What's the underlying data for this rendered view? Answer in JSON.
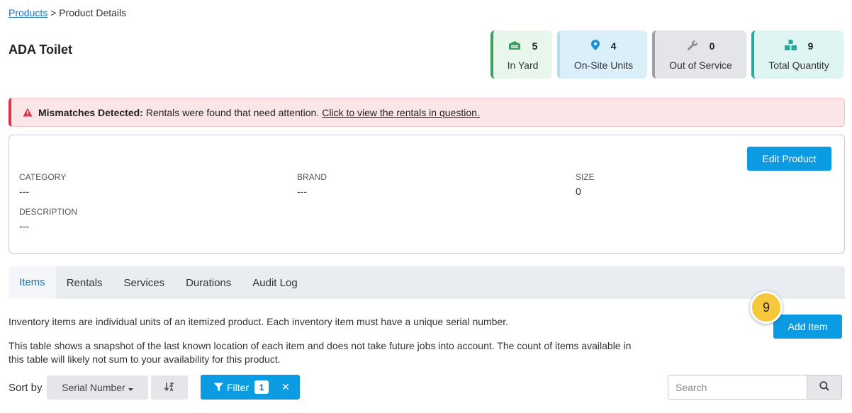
{
  "breadcrumb": {
    "link": "Products",
    "separator": ">",
    "current": "Product Details"
  },
  "product": {
    "title": "ADA Toilet"
  },
  "stats": [
    {
      "value": "5",
      "label": "In Yard",
      "icon": "warehouse-icon",
      "color": "#3aa160"
    },
    {
      "value": "4",
      "label": "On-Site Units",
      "icon": "map-pin-icon",
      "color": "#1a8fd6"
    },
    {
      "value": "0",
      "label": "Out of Service",
      "icon": "wrench-icon",
      "color": "#8b8f94"
    },
    {
      "value": "9",
      "label": "Total Quantity",
      "icon": "boxes-icon",
      "color": "#2aa89e"
    }
  ],
  "alert": {
    "title": "Mismatches Detected:",
    "message": "Rentals were found that need attention.",
    "link": "Click to view the rentals in question.",
    "color": "#d9344a"
  },
  "details": {
    "edit_label": "Edit Product",
    "fields": [
      {
        "label": "CATEGORY",
        "value": "---"
      },
      {
        "label": "BRAND",
        "value": "---"
      },
      {
        "label": "SIZE",
        "value": "0"
      },
      {
        "label": "DESCRIPTION",
        "value": "---"
      }
    ]
  },
  "tabs": [
    {
      "label": "Items",
      "active": true
    },
    {
      "label": "Rentals",
      "active": false
    },
    {
      "label": "Services",
      "active": false
    },
    {
      "label": "Durations",
      "active": false
    },
    {
      "label": "Audit Log",
      "active": false
    }
  ],
  "items_tab": {
    "description_1": "Inventory items are individual units of an itemized product. Each inventory item must have a unique serial number.",
    "description_2": "This table shows a snapshot of the last known location of each item and does not take future jobs into account. The count of items available in this table will likely not sum to your availability for this product.",
    "add_item_label": "Add Item",
    "step_badge": "9"
  },
  "toolbar": {
    "sort_label": "Sort by",
    "sort_value": "Serial Number",
    "filter_label": "Filter",
    "filter_count": "1",
    "search_placeholder": "Search"
  },
  "colors": {
    "primary": "#0b9be3",
    "link": "#1a73b8",
    "badge": "#f7c83b"
  }
}
